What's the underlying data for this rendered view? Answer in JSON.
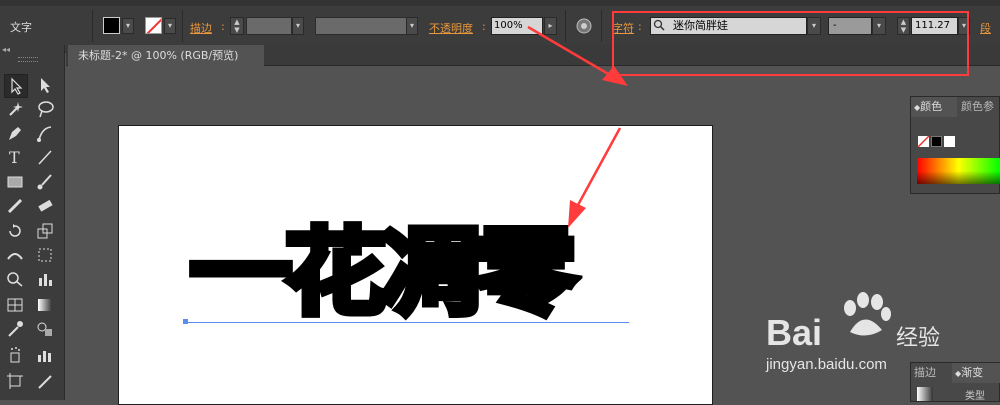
{
  "control_bar": {
    "selection_label": "文字",
    "stroke_label": "描边",
    "opacity_label": "不透明度",
    "opacity_value": "100%",
    "character_label": "字符",
    "font_family": "迷你简胖娃",
    "font_style": "-",
    "font_size": "111.27",
    "paragraph_label": "段"
  },
  "document_tab": {
    "title": "未标题-2* @ 100% (RGB/预览)"
  },
  "artboard": {
    "text": "一花凋零"
  },
  "panels": {
    "color_tab": "颜色",
    "color_guide_tab": "颜色参",
    "gradient_tab": "渐变",
    "transparency_tab": "描边",
    "type_label": "类型"
  },
  "watermark": {
    "brand": "Bai",
    "brand_suffix": "经验",
    "url": "jingyan.baidu.com"
  },
  "colors": {
    "highlight": "#ff3b3b",
    "accent_label": "#e8973c",
    "baseline": "#5b8ef0"
  }
}
